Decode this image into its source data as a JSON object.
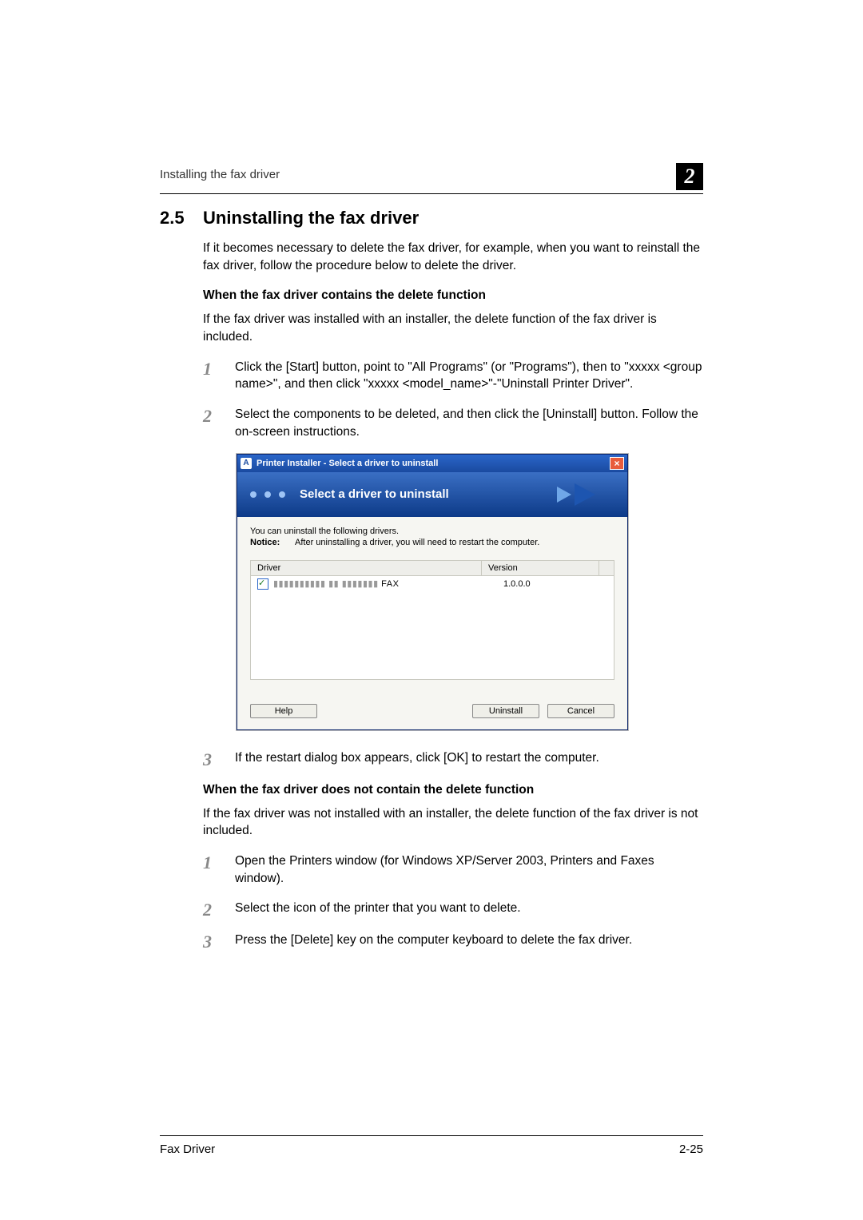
{
  "header": {
    "running_head": "Installing the fax driver",
    "chapter_number": "2"
  },
  "section": {
    "number": "2.5",
    "title": "Uninstalling the fax driver",
    "intro": "If it becomes necessary to delete the fax driver, for example, when you want to reinstall the fax driver, follow the procedure below to delete the driver."
  },
  "sub1": {
    "heading": "When the fax driver contains the delete function",
    "intro": "If the fax driver was installed with an installer, the delete function of the fax driver is included.",
    "steps": [
      "Click the [Start] button, point to \"All Programs\" (or \"Programs\"), then to \"xxxxx <group name>\", and then click \"xxxxx <model_name>\"-\"Uninstall Printer Driver\".",
      "Select the components to be deleted, and then click the [Uninstall] button. Follow the on-screen instructions.",
      "If the restart dialog box appears, click [OK] to restart the computer."
    ]
  },
  "dialog": {
    "titlebar": "Printer Installer - Select a driver to uninstall",
    "banner": "Select a driver to uninstall",
    "notice1": "You can uninstall the following drivers.",
    "notice_label": "Notice:",
    "notice_text": "After uninstalling a driver, you will need to restart the computer.",
    "col_driver": "Driver",
    "col_version": "Version",
    "row_driver_suffix": " FAX",
    "row_version": "1.0.0.0",
    "btn_help": "Help",
    "btn_uninstall": "Uninstall",
    "btn_cancel": "Cancel"
  },
  "sub2": {
    "heading": "When the fax driver does not contain the delete function",
    "intro": "If the fax driver was not installed with an installer, the delete function of the fax driver is not included.",
    "steps": [
      "Open the Printers window (for Windows XP/Server 2003, Printers and Faxes window).",
      "Select the icon of the printer that you want to delete.",
      "Press the [Delete] key on the computer keyboard to delete the fax driver."
    ]
  },
  "footer": {
    "left": "Fax Driver",
    "right": "2-25"
  }
}
